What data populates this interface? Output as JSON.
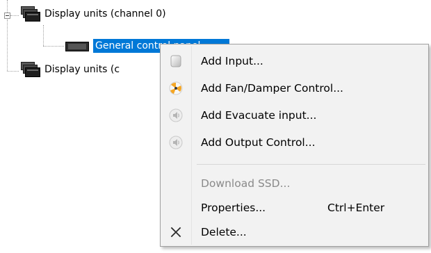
{
  "tree": {
    "nodes": [
      {
        "label": "Display units (channel 0)",
        "icon": "display-stack-icon",
        "expanded": true
      },
      {
        "label": "General control panel",
        "icon": "control-panel-icon",
        "selected": true
      },
      {
        "label": "Display units (c",
        "icon": "display-stack-icon"
      }
    ]
  },
  "context_menu": {
    "items": [
      {
        "label": "Add Input...",
        "icon": "input-icon",
        "enabled": true
      },
      {
        "label": "Add Fan/Damper Control...",
        "icon": "fan-icon",
        "enabled": true
      },
      {
        "label": "Add Evacuate input...",
        "icon": "speaker-icon",
        "enabled": true
      },
      {
        "label": "Add Output Control...",
        "icon": "speaker-icon",
        "enabled": true
      },
      {
        "label": "Download SSD...",
        "icon": "",
        "enabled": false
      },
      {
        "label": "Properties...",
        "shortcut": "Ctrl+Enter",
        "icon": "",
        "enabled": true
      },
      {
        "label": "Delete...",
        "icon": "delete-x-icon",
        "enabled": true
      }
    ]
  },
  "colors": {
    "selection": "#0078d7",
    "menu_background": "#f2f2f2",
    "disabled_text": "#8a8a8a",
    "fan_accent": "#f5a623"
  }
}
